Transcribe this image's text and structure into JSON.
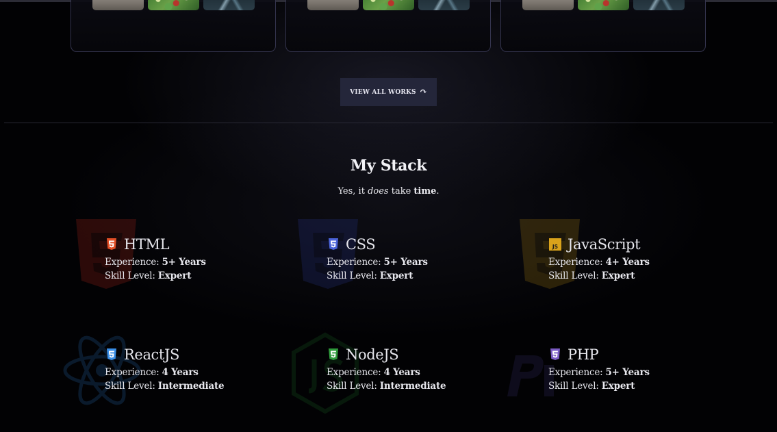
{
  "works": {
    "view_all_label": "VIEW ALL WORKS",
    "view_all_icon": "curved-arrow-icon"
  },
  "stack": {
    "title": "My Stack",
    "subtitle_parts": [
      "Yes, it ",
      "does",
      " take ",
      "time",
      "."
    ],
    "skills": [
      {
        "name": "HTML",
        "icon": "html5-icon",
        "color": "#e34f26",
        "experience_label": "Experience:",
        "experience": "5+ Years",
        "skill_label": "Skill Level:",
        "skill": "Expert"
      },
      {
        "name": "CSS",
        "icon": "css3-icon",
        "color": "#4a63d8",
        "experience_label": "Experience:",
        "experience": "5+ Years",
        "skill_label": "Skill Level:",
        "skill": "Expert"
      },
      {
        "name": "JavaScript",
        "icon": "javascript-icon",
        "color": "#d9a21b",
        "experience_label": "Experience:",
        "experience": "4+ Years",
        "skill_label": "Skill Level:",
        "skill": "Expert"
      },
      {
        "name": "ReactJS",
        "icon": "react-icon",
        "color": "#3a8ee6",
        "experience_label": "Experience:",
        "experience": "4 Years",
        "skill_label": "Skill Level:",
        "skill": "Intermediate"
      },
      {
        "name": "NodeJS",
        "icon": "nodejs-icon",
        "color": "#2e9a3b",
        "experience_label": "Experience:",
        "experience": "4 Years",
        "skill_label": "Skill Level:",
        "skill": "Intermediate"
      },
      {
        "name": "PHP",
        "icon": "php-icon",
        "color": "#7b5bc4",
        "experience_label": "Experience:",
        "experience": "5+ Years",
        "skill_label": "Skill Level:",
        "skill": "Expert"
      }
    ]
  }
}
